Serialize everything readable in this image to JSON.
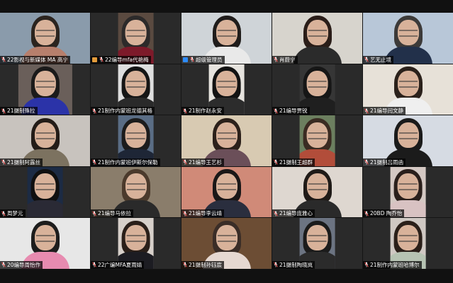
{
  "participants": [
    {
      "name": "22影视与新媒体 MA 高宁",
      "bg": "#8a9bab",
      "cloth": "#b77f6c",
      "hair": "#2b241f",
      "video_width": "full",
      "muted": true,
      "host": false
    },
    {
      "name": "22编导mfa代艳梅",
      "bg": "#5a4a40",
      "cloth": "#7d1a2a",
      "hair": "#2c2a2a",
      "video_width": "w40",
      "muted": true,
      "host": false,
      "orange_icon": true
    },
    {
      "name": "超级管理员",
      "bg": "#cfd4d8",
      "cloth": "#e9e9e9",
      "hair": "#1f1c1b",
      "video_width": "full",
      "muted": true,
      "host": true
    },
    {
      "name": "肖蔚宁",
      "bg": "#d7d4cd",
      "cloth": "#2b2b2b",
      "hair": "#2a1d18",
      "video_width": "full",
      "muted": true,
      "host": false
    },
    {
      "name": "艺无止境",
      "bg": "#b8c7d8",
      "cloth": "#22304a",
      "hair": "#3c3a39",
      "video_width": "full",
      "muted": true,
      "host": false
    },
    {
      "name": "21摄制殊拉",
      "bg": "#6a5f5a",
      "cloth": "#2b33a8",
      "hair": "#1b1a1a",
      "video_width": "w60",
      "muted": true,
      "host": false
    },
    {
      "name": "21制作内蒙班龙德其格",
      "bg": "#dedede",
      "cloth": "#2a2a2a",
      "hair": "#151515",
      "video_width": "w40",
      "muted": true,
      "host": false
    },
    {
      "name": "21制作赵永安",
      "bg": "#e6e3de",
      "cloth": "#2c2c2c",
      "hair": "#121212",
      "video_width": "w40",
      "muted": true,
      "host": false
    },
    {
      "name": "21编导贾锐",
      "bg": "#363636",
      "cloth": "#1f1f1f",
      "hair": "#161616",
      "video_width": "w40",
      "muted": true,
      "host": false
    },
    {
      "name": "21编导闫文静",
      "bg": "#e7e1d8",
      "cloth": "#efefef",
      "hair": "#2b211b",
      "video_width": "full",
      "muted": true,
      "host": false
    },
    {
      "name": "21摄制阿露丝",
      "bg": "#c8c3be",
      "cloth": "#7c7260",
      "hair": "#231c18",
      "video_width": "full",
      "muted": true,
      "host": false
    },
    {
      "name": "21制作内蒙班伊斯尔保勒",
      "bg": "#5a6d85",
      "cloth": "#1e2636",
      "hair": "#1c1c1c",
      "video_width": "w40",
      "muted": true,
      "host": false
    },
    {
      "name": "21编导王艺杉",
      "bg": "#d8cab2",
      "cloth": "#6b4f59",
      "hair": "#2b201a",
      "video_width": "full",
      "muted": true,
      "host": false
    },
    {
      "name": "21摄制王超群",
      "bg": "#6c7f5f",
      "cloth": "#b24d3a",
      "hair": "#3a2b22",
      "video_width": "w40",
      "muted": true,
      "host": false
    },
    {
      "name": "21摄制吕雨函",
      "bg": "#d6dbe3",
      "cloth": "#1b1b1b",
      "hair": "#1a1a1a",
      "video_width": "full",
      "muted": true,
      "host": false
    },
    {
      "name": "周梦元",
      "bg": "#1c2b44",
      "cloth": "#2a2a35",
      "hair": "#101010",
      "video_width": "w40",
      "muted": true,
      "host": false
    },
    {
      "name": "21编导马依拉",
      "bg": "#8a7d6b",
      "cloth": "#2a2a2a",
      "hair": "#4b3a2c",
      "video_width": "full",
      "muted": true,
      "host": false
    },
    {
      "name": "21编导李云靖",
      "bg": "#d08a78",
      "cloth": "#2a2e3e",
      "hair": "#1a1717",
      "video_width": "full",
      "muted": true,
      "host": false
    },
    {
      "name": "21编导庞雅心",
      "bg": "#ded7d0",
      "cloth": "#2a2a2a",
      "hair": "#1f1a17",
      "video_width": "full",
      "muted": true,
      "host": false
    },
    {
      "name": "20BD 陶乔怡",
      "bg": "#d4c8c3",
      "cloth": "#d8c2c2",
      "hair": "#2a1f1b",
      "video_width": "w40",
      "muted": true,
      "host": false
    },
    {
      "name": "20编导周怡作",
      "bg": "#e7e7e7",
      "cloth": "#e78bb0",
      "hair": "#1d1d1d",
      "video_width": "full",
      "muted": true,
      "host": false
    },
    {
      "name": "22广编MFA夏雨婧",
      "bg": "#d7d0ca",
      "cloth": "#1c1c22",
      "hair": "#2a1f19",
      "video_width": "w40",
      "muted": true,
      "host": false
    },
    {
      "name": "21摄制孙钰宸",
      "bg": "#6c4d34",
      "cloth": "#e5d8d1",
      "hair": "#3a2d27",
      "video_width": "full",
      "muted": true,
      "host": false
    },
    {
      "name": "21摄制陶晓岚",
      "bg": "#6c7482",
      "cloth": "#2b2b2b",
      "hair": "#1b1b1b",
      "video_width": "w40",
      "muted": true,
      "host": false
    },
    {
      "name": "21制作内蒙班哈博尔",
      "bg": "#cfc8c3",
      "cloth": "#b6c3b3",
      "hair": "#2a1f19",
      "video_width": "w40",
      "muted": true,
      "host": false
    }
  ]
}
